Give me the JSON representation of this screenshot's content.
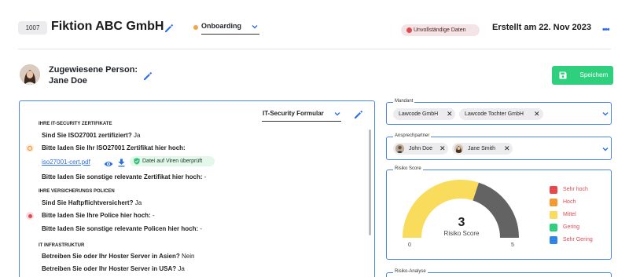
{
  "header": {
    "id": "1007",
    "title": "Fiktion ABC GmbH",
    "status": "Onboarding",
    "alert": "Unvollständige Daten",
    "created": "Erstellt am 22. Nov 2023",
    "more": "•••"
  },
  "assigned": {
    "label_line1": "Zugewiesene Person:",
    "label_line2": "Jane Doe"
  },
  "save_label": "Speichern",
  "form": {
    "selector": "IT-Security Formular",
    "sections": {
      "cert": "IHRE IT-SECURITY ZERTIFIKATE",
      "insurance": "IHRE VERSICHERUNGS POLICEN",
      "infra": "IT INFRASTRUKTUR"
    },
    "questions": {
      "q1": "Sind Sie ISO27001 zertifiziert?",
      "a1": "Ja",
      "q2": "Bitte laden Sie Ihr ISO27001 Zertifikat hier hoch:",
      "file": "iso27001-cert.pdf",
      "scan": "Datei auf Viren überprüft",
      "q3": "Bitte laden Sie sonstige relevante Zertifikat hier hoch:",
      "a3": "-",
      "q4": "Sind Sie Haftpflichtversichert?",
      "a4": "Ja",
      "q5": "Bitte laden Sie Ihre Police hier hoch:",
      "a5": "-",
      "q6": "Bitte laden Sie sonstige relevante Policen hier hoch:",
      "a6": "-",
      "q7": "Betreiben Sie oder Ihr Hoster Server in Asien?",
      "a7": "Nein",
      "q8": "Betreiben Sie oder Ihr Hoster Server in USA?",
      "a8": "Ja"
    }
  },
  "mandant": {
    "legend": "Mandant",
    "chips": [
      "Lawcode GmbH",
      "Lawcode Tochter GmbH"
    ]
  },
  "ansprech": {
    "legend": "Ansprechpartner",
    "chips": [
      "John Doe",
      "Jane Smith"
    ]
  },
  "risk": {
    "legend": "Risiko Score",
    "score": "3",
    "score_label": "Risiko Score",
    "min": "0",
    "max": "5",
    "score_fraction": 0.6,
    "colors": {
      "fill": "#f9dc5c",
      "rest": "#636363"
    },
    "legend_items": [
      {
        "label": "Sehr hoch",
        "color": "#e8484c"
      },
      {
        "label": "Hoch",
        "color": "#f59a2f"
      },
      {
        "label": "Mittel",
        "color": "#f9dc5c"
      },
      {
        "label": "Gering",
        "color": "#2ed07d"
      },
      {
        "label": "Sehr Gering",
        "color": "#2f86e8"
      }
    ]
  },
  "analysis": {
    "legend": "Risiko-Analyse"
  }
}
